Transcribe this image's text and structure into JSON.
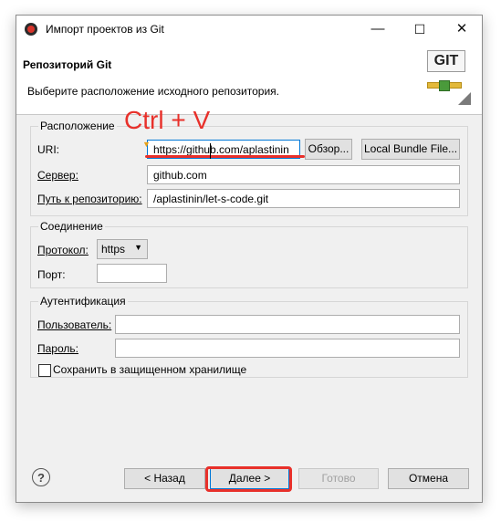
{
  "window": {
    "title": "Импорт проектов из Git",
    "minimize_glyph": "—",
    "maximize_glyph": "☐",
    "close_glyph": "✕"
  },
  "header": {
    "title": "Репозиторий Git",
    "description": "Выберите расположение исходного репозитория.",
    "logo_text": "GIT"
  },
  "location": {
    "legend": "Расположение",
    "uri_label": "URI:",
    "uri_value": "https://github.com/aplastinin",
    "browse_label": "Обзор...",
    "local_bundle_label": "Local Bundle File...",
    "server_label": "Сервер:",
    "server_value": "github.com",
    "path_label": "Путь к репозиторию:",
    "path_value": "/aplastinin/let-s-code.git"
  },
  "connection": {
    "legend": "Соединение",
    "protocol_label": "Протокол:",
    "protocol_value": "https",
    "port_label": "Порт:",
    "port_value": ""
  },
  "auth": {
    "legend": "Аутентификация",
    "user_label": "Пользователь:",
    "user_value": "",
    "password_label": "Пароль:",
    "password_value": "",
    "store_label": "Сохранить в защищенном хранилище",
    "store_checked": false
  },
  "footer": {
    "help_glyph": "?",
    "back_label": "< Назад",
    "next_label": "Далее >",
    "finish_label": "Готово",
    "cancel_label": "Отмена"
  },
  "annotation": {
    "text": "Ctrl + V",
    "color": "#e8302a"
  }
}
